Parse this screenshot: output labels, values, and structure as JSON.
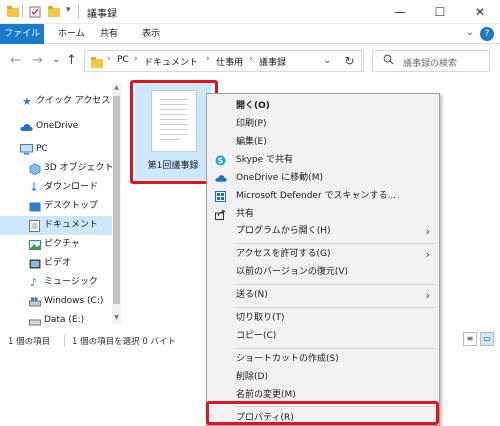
{
  "window": {
    "title": "議事録",
    "minimize": "—",
    "maximize": "☐",
    "close": "✕"
  },
  "ribbon": {
    "tabs": [
      "ファイル",
      "ホーム",
      "共有",
      "表示"
    ],
    "expand": "⌄",
    "help": "?"
  },
  "nav": {
    "back": "←",
    "forward": "→",
    "recent": "⌄",
    "up": "↑",
    "breadcrumb": [
      "PC",
      "ドキュメント",
      "仕事用",
      "議事録"
    ],
    "separator": "›",
    "dropdown": "⌄",
    "refresh": "↻",
    "search_placeholder": "議事録の検索"
  },
  "sidebar": {
    "items": [
      {
        "label": "クイック アクセス",
        "icon": "star-icon"
      },
      {
        "label": "OneDrive",
        "icon": "cloud-icon"
      },
      {
        "label": "PC",
        "icon": "pc-icon"
      },
      {
        "label": "3D オブジェクト",
        "icon": "3d-objects-icon"
      },
      {
        "label": "ダウンロード",
        "icon": "download-icon"
      },
      {
        "label": "デスクトップ",
        "icon": "desktop-icon"
      },
      {
        "label": "ドキュメント",
        "icon": "documents-icon",
        "selected": true
      },
      {
        "label": "ピクチャ",
        "icon": "pictures-icon"
      },
      {
        "label": "ビデオ",
        "icon": "videos-icon"
      },
      {
        "label": "ミュージック",
        "icon": "music-icon"
      },
      {
        "label": "Windows (C:)",
        "icon": "drive-icon"
      },
      {
        "label": "Data (E:)",
        "icon": "drive-icon"
      }
    ]
  },
  "content": {
    "files": [
      {
        "name": "第1回議事録",
        "icon": "text-document-icon"
      }
    ]
  },
  "status": {
    "item_count": "1 個の項目",
    "selected": "1 個の項目を選択 0 バイト"
  },
  "context_menu": {
    "items": [
      {
        "label": "開く(O)",
        "bold": true
      },
      {
        "label": "印刷(P)"
      },
      {
        "label": "編集(E)"
      },
      {
        "label": "Skype で共有",
        "icon": "skype-icon"
      },
      {
        "label": "OneDrive に移動(M)",
        "icon": "onedrive-icon"
      },
      {
        "label": "Microsoft Defender でスキャンする...",
        "icon": "defender-icon"
      },
      {
        "label": "共有",
        "icon": "share-icon"
      },
      {
        "label": "プログラムから開く(H)",
        "submenu": true
      },
      {
        "label": "アクセスを許可する(G)",
        "submenu": true
      },
      {
        "label": "以前のバージョンの復元(V)"
      },
      {
        "label": "送る(N)",
        "submenu": true
      },
      {
        "label": "切り取り(T)"
      },
      {
        "label": "コピー(C)"
      },
      {
        "label": "ショートカットの作成(S)"
      },
      {
        "label": "削除(D)"
      },
      {
        "label": "名前の変更(M)"
      },
      {
        "label": "プロパティ(R)"
      }
    ],
    "submenu_arrow": "›"
  },
  "colors": {
    "accent": "#1979ca",
    "selection": "#cce8ff",
    "highlight_box": "#e0141e",
    "menu_bg": "#f2f2f2"
  }
}
